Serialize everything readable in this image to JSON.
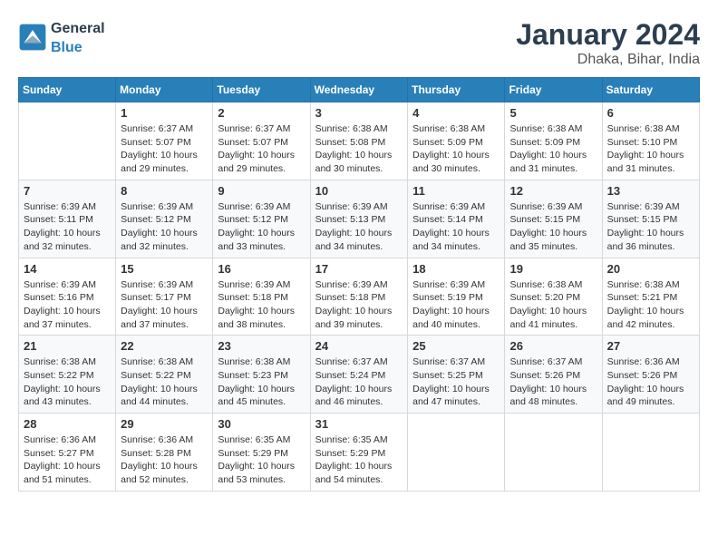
{
  "logo": {
    "general": "General",
    "blue": "Blue"
  },
  "title": {
    "month_year": "January 2024",
    "location": "Dhaka, Bihar, India"
  },
  "weekdays": [
    "Sunday",
    "Monday",
    "Tuesday",
    "Wednesday",
    "Thursday",
    "Friday",
    "Saturday"
  ],
  "weeks": [
    [
      {
        "day": "",
        "info": ""
      },
      {
        "day": "1",
        "info": "Sunrise: 6:37 AM\nSunset: 5:07 PM\nDaylight: 10 hours\nand 29 minutes."
      },
      {
        "day": "2",
        "info": "Sunrise: 6:37 AM\nSunset: 5:07 PM\nDaylight: 10 hours\nand 29 minutes."
      },
      {
        "day": "3",
        "info": "Sunrise: 6:38 AM\nSunset: 5:08 PM\nDaylight: 10 hours\nand 30 minutes."
      },
      {
        "day": "4",
        "info": "Sunrise: 6:38 AM\nSunset: 5:09 PM\nDaylight: 10 hours\nand 30 minutes."
      },
      {
        "day": "5",
        "info": "Sunrise: 6:38 AM\nSunset: 5:09 PM\nDaylight: 10 hours\nand 31 minutes."
      },
      {
        "day": "6",
        "info": "Sunrise: 6:38 AM\nSunset: 5:10 PM\nDaylight: 10 hours\nand 31 minutes."
      }
    ],
    [
      {
        "day": "7",
        "info": "Sunrise: 6:39 AM\nSunset: 5:11 PM\nDaylight: 10 hours\nand 32 minutes."
      },
      {
        "day": "8",
        "info": "Sunrise: 6:39 AM\nSunset: 5:12 PM\nDaylight: 10 hours\nand 32 minutes."
      },
      {
        "day": "9",
        "info": "Sunrise: 6:39 AM\nSunset: 5:12 PM\nDaylight: 10 hours\nand 33 minutes."
      },
      {
        "day": "10",
        "info": "Sunrise: 6:39 AM\nSunset: 5:13 PM\nDaylight: 10 hours\nand 34 minutes."
      },
      {
        "day": "11",
        "info": "Sunrise: 6:39 AM\nSunset: 5:14 PM\nDaylight: 10 hours\nand 34 minutes."
      },
      {
        "day": "12",
        "info": "Sunrise: 6:39 AM\nSunset: 5:15 PM\nDaylight: 10 hours\nand 35 minutes."
      },
      {
        "day": "13",
        "info": "Sunrise: 6:39 AM\nSunset: 5:15 PM\nDaylight: 10 hours\nand 36 minutes."
      }
    ],
    [
      {
        "day": "14",
        "info": "Sunrise: 6:39 AM\nSunset: 5:16 PM\nDaylight: 10 hours\nand 37 minutes."
      },
      {
        "day": "15",
        "info": "Sunrise: 6:39 AM\nSunset: 5:17 PM\nDaylight: 10 hours\nand 37 minutes."
      },
      {
        "day": "16",
        "info": "Sunrise: 6:39 AM\nSunset: 5:18 PM\nDaylight: 10 hours\nand 38 minutes."
      },
      {
        "day": "17",
        "info": "Sunrise: 6:39 AM\nSunset: 5:18 PM\nDaylight: 10 hours\nand 39 minutes."
      },
      {
        "day": "18",
        "info": "Sunrise: 6:39 AM\nSunset: 5:19 PM\nDaylight: 10 hours\nand 40 minutes."
      },
      {
        "day": "19",
        "info": "Sunrise: 6:38 AM\nSunset: 5:20 PM\nDaylight: 10 hours\nand 41 minutes."
      },
      {
        "day": "20",
        "info": "Sunrise: 6:38 AM\nSunset: 5:21 PM\nDaylight: 10 hours\nand 42 minutes."
      }
    ],
    [
      {
        "day": "21",
        "info": "Sunrise: 6:38 AM\nSunset: 5:22 PM\nDaylight: 10 hours\nand 43 minutes."
      },
      {
        "day": "22",
        "info": "Sunrise: 6:38 AM\nSunset: 5:22 PM\nDaylight: 10 hours\nand 44 minutes."
      },
      {
        "day": "23",
        "info": "Sunrise: 6:38 AM\nSunset: 5:23 PM\nDaylight: 10 hours\nand 45 minutes."
      },
      {
        "day": "24",
        "info": "Sunrise: 6:37 AM\nSunset: 5:24 PM\nDaylight: 10 hours\nand 46 minutes."
      },
      {
        "day": "25",
        "info": "Sunrise: 6:37 AM\nSunset: 5:25 PM\nDaylight: 10 hours\nand 47 minutes."
      },
      {
        "day": "26",
        "info": "Sunrise: 6:37 AM\nSunset: 5:26 PM\nDaylight: 10 hours\nand 48 minutes."
      },
      {
        "day": "27",
        "info": "Sunrise: 6:36 AM\nSunset: 5:26 PM\nDaylight: 10 hours\nand 49 minutes."
      }
    ],
    [
      {
        "day": "28",
        "info": "Sunrise: 6:36 AM\nSunset: 5:27 PM\nDaylight: 10 hours\nand 51 minutes."
      },
      {
        "day": "29",
        "info": "Sunrise: 6:36 AM\nSunset: 5:28 PM\nDaylight: 10 hours\nand 52 minutes."
      },
      {
        "day": "30",
        "info": "Sunrise: 6:35 AM\nSunset: 5:29 PM\nDaylight: 10 hours\nand 53 minutes."
      },
      {
        "day": "31",
        "info": "Sunrise: 6:35 AM\nSunset: 5:29 PM\nDaylight: 10 hours\nand 54 minutes."
      },
      {
        "day": "",
        "info": ""
      },
      {
        "day": "",
        "info": ""
      },
      {
        "day": "",
        "info": ""
      }
    ]
  ]
}
